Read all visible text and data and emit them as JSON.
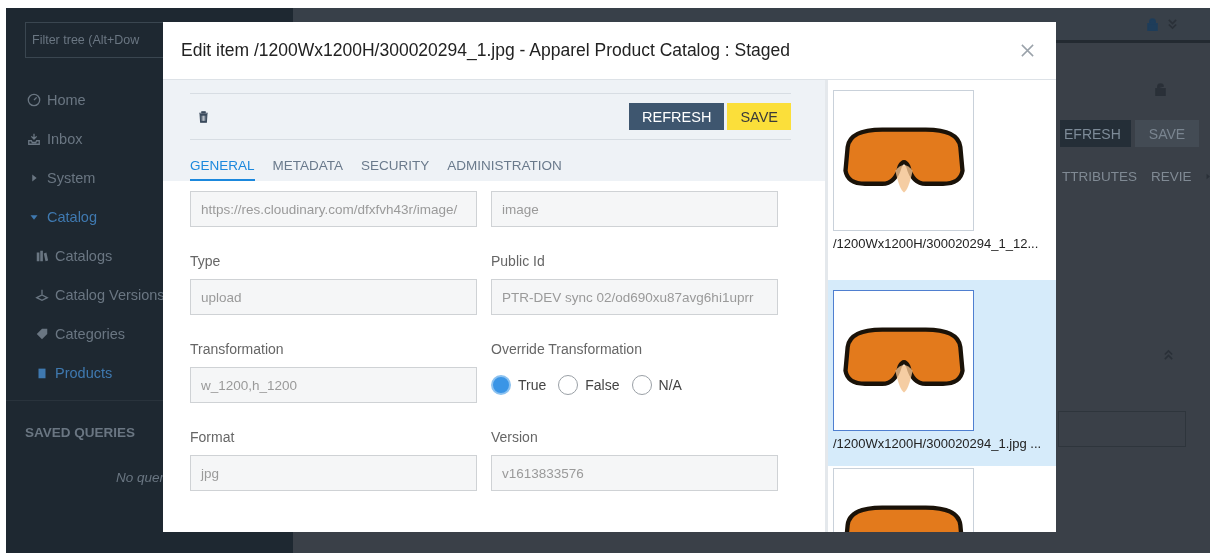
{
  "sidebar": {
    "filter": {
      "placeholder": "Filter tree (Alt+Dow"
    },
    "items": [
      {
        "label": "Home",
        "selected": false
      },
      {
        "label": "Inbox",
        "selected": false
      },
      {
        "label": "System",
        "selected": false
      },
      {
        "label": "Catalog",
        "selected": true,
        "children": [
          {
            "label": "Catalogs",
            "selected": false
          },
          {
            "label": "Catalog Versions",
            "selected": false
          },
          {
            "label": "Categories",
            "selected": false
          },
          {
            "label": "Products",
            "selected": true
          }
        ]
      }
    ],
    "saved_queries": {
      "title": "SAVED QUERIES",
      "empty": "No quer"
    }
  },
  "background_editor": {
    "buttons": [
      "EFRESH",
      "SAVE"
    ],
    "tabs": [
      "TTRIBUTES",
      "REVIE"
    ]
  },
  "modal": {
    "title": "Edit item /1200Wx1200H/300020294_1.jpg - Apparel Product Catalog : Staged",
    "buttons": [
      {
        "label": "REFRESH",
        "kind": "primary"
      },
      {
        "label": "SAVE",
        "kind": "save"
      }
    ],
    "tabs": [
      {
        "label": "GENERAL",
        "selected": true
      },
      {
        "label": "METADATA",
        "selected": false
      },
      {
        "label": "SECURITY",
        "selected": false
      },
      {
        "label": "ADMINISTRATION",
        "selected": false
      }
    ],
    "fields": [
      {
        "kind": "text",
        "value": "https://res.cloudinary.com/dfxfvh43r/image/"
      },
      {
        "kind": "text",
        "value": "image"
      },
      {
        "kind": "text",
        "label": "Type",
        "value": "upload"
      },
      {
        "kind": "text",
        "label": "Public Id",
        "value": "PTR-DEV sync 02/od690xu87avg6hi1uprr"
      },
      {
        "kind": "text",
        "label": "Transformation",
        "value": "w_1200,h_1200"
      },
      {
        "kind": "radio",
        "label": "Override Transformation",
        "options": [
          {
            "label": "True",
            "selected": true
          },
          {
            "label": "False",
            "selected": false
          },
          {
            "label": "N/A",
            "selected": false
          }
        ]
      },
      {
        "kind": "text",
        "label": "Format",
        "value": "jpg"
      },
      {
        "kind": "text",
        "label": "Version",
        "value": "v1613833576"
      }
    ],
    "thumbnails": [
      {
        "caption": "/1200Wx1200H/300020294_1_12...",
        "selected": false
      },
      {
        "caption": "/1200Wx1200H/300020294_1.jpg ...",
        "selected": true
      },
      {
        "selected": false
      }
    ]
  }
}
